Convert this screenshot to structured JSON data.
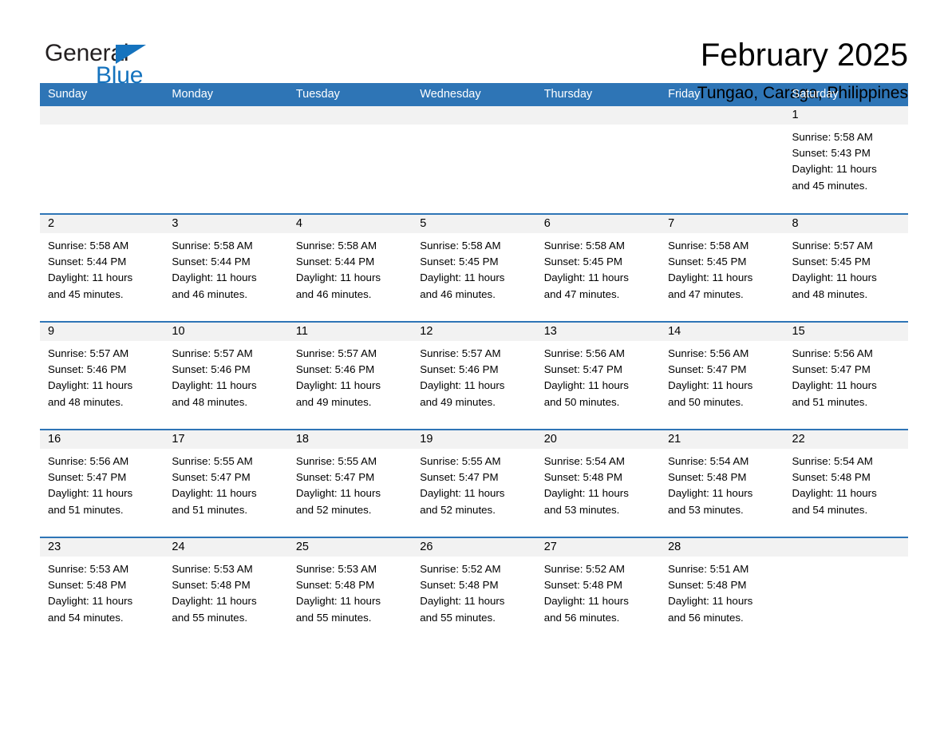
{
  "brand": {
    "name_part1": "General",
    "name_part2": "Blue",
    "triangle_color": "#1573be"
  },
  "header": {
    "month_title": "February 2025",
    "location": "Tungao, Caraga, Philippines",
    "accent_color": "#2e75b6"
  },
  "weekday_headers": [
    "Sunday",
    "Monday",
    "Tuesday",
    "Wednesday",
    "Thursday",
    "Friday",
    "Saturday"
  ],
  "weeks": [
    [
      {
        "day": "",
        "lines": []
      },
      {
        "day": "",
        "lines": []
      },
      {
        "day": "",
        "lines": []
      },
      {
        "day": "",
        "lines": []
      },
      {
        "day": "",
        "lines": []
      },
      {
        "day": "",
        "lines": []
      },
      {
        "day": "1",
        "lines": [
          "Sunrise: 5:58 AM",
          "Sunset: 5:43 PM",
          "Daylight: 11 hours",
          "and 45 minutes."
        ]
      }
    ],
    [
      {
        "day": "2",
        "lines": [
          "Sunrise: 5:58 AM",
          "Sunset: 5:44 PM",
          "Daylight: 11 hours",
          "and 45 minutes."
        ]
      },
      {
        "day": "3",
        "lines": [
          "Sunrise: 5:58 AM",
          "Sunset: 5:44 PM",
          "Daylight: 11 hours",
          "and 46 minutes."
        ]
      },
      {
        "day": "4",
        "lines": [
          "Sunrise: 5:58 AM",
          "Sunset: 5:44 PM",
          "Daylight: 11 hours",
          "and 46 minutes."
        ]
      },
      {
        "day": "5",
        "lines": [
          "Sunrise: 5:58 AM",
          "Sunset: 5:45 PM",
          "Daylight: 11 hours",
          "and 46 minutes."
        ]
      },
      {
        "day": "6",
        "lines": [
          "Sunrise: 5:58 AM",
          "Sunset: 5:45 PM",
          "Daylight: 11 hours",
          "and 47 minutes."
        ]
      },
      {
        "day": "7",
        "lines": [
          "Sunrise: 5:58 AM",
          "Sunset: 5:45 PM",
          "Daylight: 11 hours",
          "and 47 minutes."
        ]
      },
      {
        "day": "8",
        "lines": [
          "Sunrise: 5:57 AM",
          "Sunset: 5:45 PM",
          "Daylight: 11 hours",
          "and 48 minutes."
        ]
      }
    ],
    [
      {
        "day": "9",
        "lines": [
          "Sunrise: 5:57 AM",
          "Sunset: 5:46 PM",
          "Daylight: 11 hours",
          "and 48 minutes."
        ]
      },
      {
        "day": "10",
        "lines": [
          "Sunrise: 5:57 AM",
          "Sunset: 5:46 PM",
          "Daylight: 11 hours",
          "and 48 minutes."
        ]
      },
      {
        "day": "11",
        "lines": [
          "Sunrise: 5:57 AM",
          "Sunset: 5:46 PM",
          "Daylight: 11 hours",
          "and 49 minutes."
        ]
      },
      {
        "day": "12",
        "lines": [
          "Sunrise: 5:57 AM",
          "Sunset: 5:46 PM",
          "Daylight: 11 hours",
          "and 49 minutes."
        ]
      },
      {
        "day": "13",
        "lines": [
          "Sunrise: 5:56 AM",
          "Sunset: 5:47 PM",
          "Daylight: 11 hours",
          "and 50 minutes."
        ]
      },
      {
        "day": "14",
        "lines": [
          "Sunrise: 5:56 AM",
          "Sunset: 5:47 PM",
          "Daylight: 11 hours",
          "and 50 minutes."
        ]
      },
      {
        "day": "15",
        "lines": [
          "Sunrise: 5:56 AM",
          "Sunset: 5:47 PM",
          "Daylight: 11 hours",
          "and 51 minutes."
        ]
      }
    ],
    [
      {
        "day": "16",
        "lines": [
          "Sunrise: 5:56 AM",
          "Sunset: 5:47 PM",
          "Daylight: 11 hours",
          "and 51 minutes."
        ]
      },
      {
        "day": "17",
        "lines": [
          "Sunrise: 5:55 AM",
          "Sunset: 5:47 PM",
          "Daylight: 11 hours",
          "and 51 minutes."
        ]
      },
      {
        "day": "18",
        "lines": [
          "Sunrise: 5:55 AM",
          "Sunset: 5:47 PM",
          "Daylight: 11 hours",
          "and 52 minutes."
        ]
      },
      {
        "day": "19",
        "lines": [
          "Sunrise: 5:55 AM",
          "Sunset: 5:47 PM",
          "Daylight: 11 hours",
          "and 52 minutes."
        ]
      },
      {
        "day": "20",
        "lines": [
          "Sunrise: 5:54 AM",
          "Sunset: 5:48 PM",
          "Daylight: 11 hours",
          "and 53 minutes."
        ]
      },
      {
        "day": "21",
        "lines": [
          "Sunrise: 5:54 AM",
          "Sunset: 5:48 PM",
          "Daylight: 11 hours",
          "and 53 minutes."
        ]
      },
      {
        "day": "22",
        "lines": [
          "Sunrise: 5:54 AM",
          "Sunset: 5:48 PM",
          "Daylight: 11 hours",
          "and 54 minutes."
        ]
      }
    ],
    [
      {
        "day": "23",
        "lines": [
          "Sunrise: 5:53 AM",
          "Sunset: 5:48 PM",
          "Daylight: 11 hours",
          "and 54 minutes."
        ]
      },
      {
        "day": "24",
        "lines": [
          "Sunrise: 5:53 AM",
          "Sunset: 5:48 PM",
          "Daylight: 11 hours",
          "and 55 minutes."
        ]
      },
      {
        "day": "25",
        "lines": [
          "Sunrise: 5:53 AM",
          "Sunset: 5:48 PM",
          "Daylight: 11 hours",
          "and 55 minutes."
        ]
      },
      {
        "day": "26",
        "lines": [
          "Sunrise: 5:52 AM",
          "Sunset: 5:48 PM",
          "Daylight: 11 hours",
          "and 55 minutes."
        ]
      },
      {
        "day": "27",
        "lines": [
          "Sunrise: 5:52 AM",
          "Sunset: 5:48 PM",
          "Daylight: 11 hours",
          "and 56 minutes."
        ]
      },
      {
        "day": "28",
        "lines": [
          "Sunrise: 5:51 AM",
          "Sunset: 5:48 PM",
          "Daylight: 11 hours",
          "and 56 minutes."
        ]
      },
      {
        "day": "",
        "lines": []
      }
    ]
  ]
}
